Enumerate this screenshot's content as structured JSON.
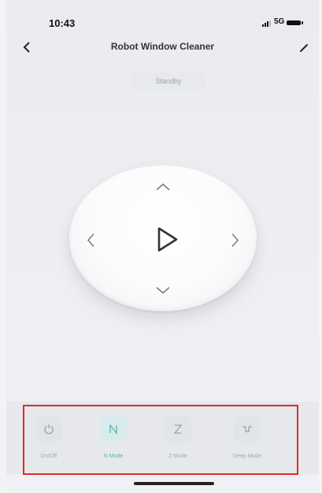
{
  "status_bar": {
    "time": "10:43",
    "network": "5G"
  },
  "header": {
    "title": "Robot Window Cleaner"
  },
  "device": {
    "status": "Standby"
  },
  "modes": [
    {
      "label": "On/Off",
      "icon": "power-icon"
    },
    {
      "label": "N Mode",
      "icon": "n-mode-icon"
    },
    {
      "label": "Z Mode",
      "icon": "z-mode-icon"
    },
    {
      "label": "Deep Mode",
      "icon": "deep-mode-icon"
    }
  ],
  "colors": {
    "accent": "#4fb8b8",
    "highlight": "#e02a2a"
  }
}
